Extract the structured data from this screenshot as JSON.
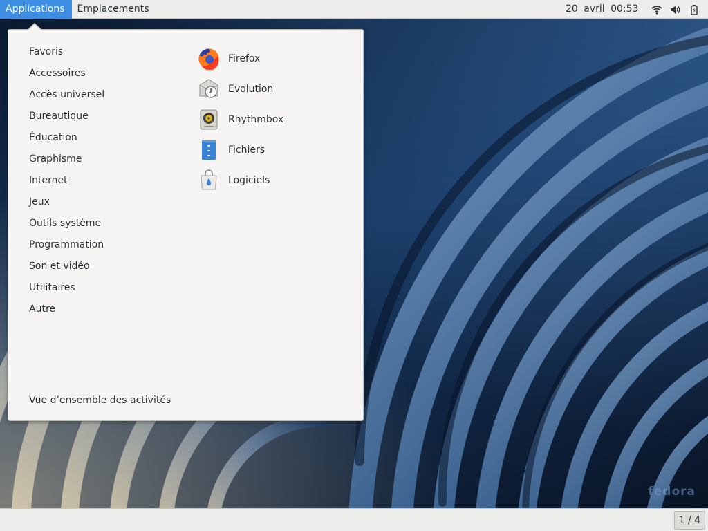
{
  "topbar": {
    "applications_label": "Applications",
    "places_label": "Emplacements",
    "clock": "20 avril  00:53",
    "tray_icons": [
      "network-wireless-icon",
      "audio-volume-icon",
      "battery-icon"
    ]
  },
  "menu": {
    "categories": [
      "Favoris",
      "Accessoires",
      "Accès universel",
      "Bureautique",
      "Éducation",
      "Graphisme",
      "Internet",
      "Jeux",
      "Outils système",
      "Programmation",
      "Son et vidéo",
      "Utilitaires",
      "Autre"
    ],
    "apps": [
      {
        "label": "Firefox",
        "icon": "firefox-icon"
      },
      {
        "label": "Evolution",
        "icon": "evolution-icon"
      },
      {
        "label": "Rhythmbox",
        "icon": "rhythmbox-icon"
      },
      {
        "label": "Fichiers",
        "icon": "files-icon"
      },
      {
        "label": "Logiciels",
        "icon": "software-icon"
      }
    ],
    "overview_label": "Vue d’ensemble des activités"
  },
  "desktop": {
    "watermark": "fedora"
  },
  "bottombar": {
    "workspace": "1 / 4"
  },
  "colors": {
    "accent": "#3d8ee3",
    "panel": "#ededeb",
    "menu_bg": "#f6f5f4"
  }
}
